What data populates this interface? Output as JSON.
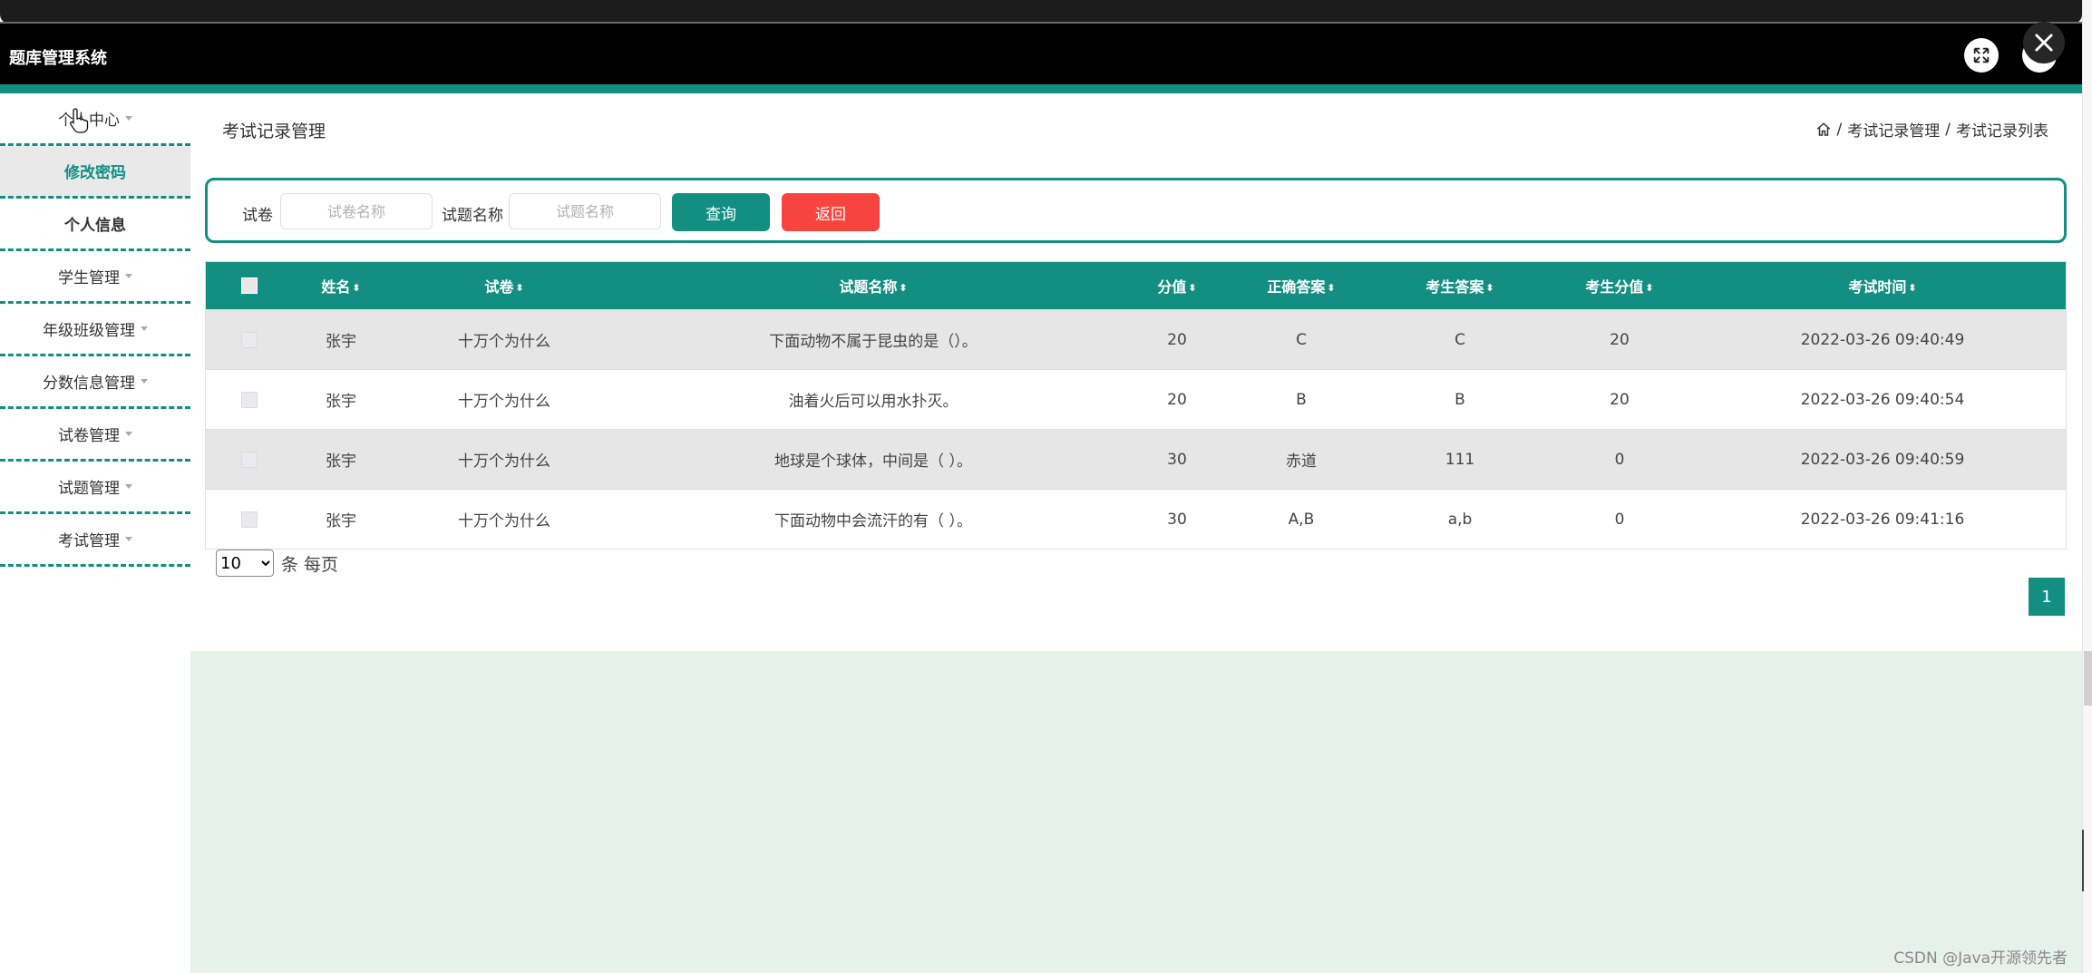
{
  "app": {
    "title": "题库管理系统"
  },
  "sidebar": {
    "items": [
      {
        "label": "个人中心",
        "type": "group"
      },
      {
        "label": "修改密码",
        "type": "sub",
        "active": true
      },
      {
        "label": "个人信息",
        "type": "sub",
        "active": false
      },
      {
        "label": "学生管理",
        "type": "group"
      },
      {
        "label": "年级班级管理",
        "type": "group"
      },
      {
        "label": "分数信息管理",
        "type": "group"
      },
      {
        "label": "试卷管理",
        "type": "group"
      },
      {
        "label": "试题管理",
        "type": "group"
      },
      {
        "label": "考试管理",
        "type": "group"
      }
    ]
  },
  "page": {
    "title": "考试记录管理",
    "breadcrumb": [
      "考试记录管理",
      "考试记录列表"
    ],
    "breadcrumb_sep": "/"
  },
  "search": {
    "paper_label": "试卷",
    "paper_placeholder": "试卷名称",
    "question_label": "试题名称",
    "question_placeholder": "试题名称",
    "query_button": "查询",
    "back_button": "返回"
  },
  "table": {
    "columns": [
      "姓名",
      "试卷",
      "试题名称",
      "分值",
      "正确答案",
      "考生答案",
      "考生分值",
      "考试时间"
    ],
    "sort_glyph": "⬍",
    "rows": [
      [
        "张宇",
        "十万个为什么",
        "下面动物不属于昆虫的是（）。",
        "20",
        "C",
        "C",
        "20",
        "2022-03-26 09:40:49"
      ],
      [
        "张宇",
        "十万个为什么",
        "油着火后可以用水扑灭。",
        "20",
        "B",
        "B",
        "20",
        "2022-03-26 09:40:54"
      ],
      [
        "张宇",
        "十万个为什么",
        "地球是个球体，中间是（ ）。",
        "30",
        "赤道",
        "111",
        "0",
        "2022-03-26 09:40:59"
      ],
      [
        "张宇",
        "十万个为什么",
        "下面动物中会流汗的有（ ）。",
        "30",
        "A,B",
        "a,b",
        "0",
        "2022-03-26 09:41:16"
      ]
    ]
  },
  "pagination": {
    "page_size": "10",
    "page_size_suffix": "条 每页",
    "current_page": "1"
  },
  "watermark": "CSDN @Java开源领先者",
  "colors": {
    "primary": "#138f82",
    "danger": "#f8443e",
    "header": "#000000",
    "panel": "#e7f1ec"
  }
}
